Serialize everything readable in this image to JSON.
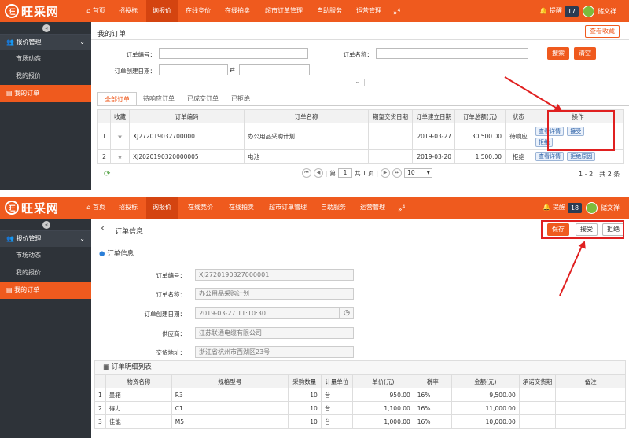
{
  "logo": {
    "mark": "旺",
    "text": "旺采网"
  },
  "nav": {
    "items": [
      "首页",
      "招投标",
      "询报价",
      "在线竞价",
      "在线拍卖",
      "超市订单管理",
      "自助服务",
      "运营管理"
    ],
    "more": "»",
    "more_count": "4"
  },
  "notice": {
    "label": "提醒"
  },
  "user": {
    "name": "储文祥"
  },
  "sidebar": {
    "toggle": "«",
    "group": "报价管理",
    "items": [
      "市场动态",
      "我的报价",
      "我的订单"
    ]
  },
  "panel1": {
    "notice_count": "17",
    "page_title": "我的订单",
    "view_fav": "查看收藏",
    "search": {
      "order_no_label": "订单编号：",
      "order_name_label": "订单名称：",
      "created_date_label": "订单创建日期：",
      "range_sep": "⇄",
      "search_btn": "搜索",
      "clear_btn": "清空",
      "collapse": "⌄"
    },
    "tabs": [
      "全部订单",
      "待响应订单",
      "已成交订单",
      "已拒绝"
    ],
    "table": {
      "headers": [
        "",
        "收藏",
        "订单编码",
        "订单名称",
        "期望交货日期",
        "订单建立日期",
        "订单总额(元)",
        "状态",
        "操作"
      ],
      "rows": [
        {
          "idx": "1",
          "code": "XJ2720190327000001",
          "name": "办公用品采购计划",
          "expected": "",
          "created": "2019-03-27",
          "total": "30,500.00",
          "status": "待响应",
          "actions": [
            "查看详情",
            "接受",
            "拒绝"
          ]
        },
        {
          "idx": "2",
          "code": "XJ2020190320000005",
          "name": "电池",
          "expected": "",
          "created": "2019-03-20",
          "total": "1,500.00",
          "status": "拒绝",
          "actions": [
            "查看详情",
            "拒绝原因"
          ]
        }
      ]
    },
    "pager": {
      "page_label_pre": "第",
      "page": "1",
      "page_label_post": "共 1 页",
      "size": "10",
      "summary": "1 - 2　共 2 条",
      "refresh": "⟳"
    }
  },
  "panel2": {
    "notice_count": "18",
    "back": "‹",
    "page_title": "订单信息",
    "save": "保存",
    "accept": "接受",
    "reject": "拒绝",
    "section_title": "订单信息",
    "fields": [
      {
        "label": "订单编号：",
        "value": "XJ2720190327000001"
      },
      {
        "label": "订单名称：",
        "value": "办公用品采购计划"
      },
      {
        "label": "订单创建日期：",
        "value": "2019-03-27 11:10:30"
      },
      {
        "label": "供应商：",
        "value": "江苏联通电缆有限公司"
      },
      {
        "label": "交货地址：",
        "value": "浙江省杭州市西湖区23号"
      }
    ],
    "clock": "◷",
    "detail_title": "订单明细列表",
    "detail": {
      "headers": [
        "",
        "物资名称",
        "规格型号",
        "采购数量",
        "计量单位",
        "单价(元)",
        "税率",
        "金额(元)",
        "承诺交货期",
        "备注"
      ],
      "rows": [
        {
          "idx": "1",
          "name": "墨箱",
          "spec": "R3",
          "qty": "10",
          "unit": "台",
          "price": "950.00",
          "tax": "16%",
          "amount": "9,500.00"
        },
        {
          "idx": "2",
          "name": "得力",
          "spec": "C1",
          "qty": "10",
          "unit": "台",
          "price": "1,100.00",
          "tax": "16%",
          "amount": "11,000.00"
        },
        {
          "idx": "3",
          "name": "佳能",
          "spec": "M5",
          "qty": "10",
          "unit": "台",
          "price": "1,000.00",
          "tax": "16%",
          "amount": "10,000.00"
        }
      ]
    }
  },
  "colors": {
    "brand": "#ef5a1e",
    "sidebar": "#2e3339",
    "annotation": "#e02020"
  },
  "icons": [
    "home-icon",
    "bell-icon",
    "chevron-down-icon",
    "users-icon",
    "order-icon",
    "star-icon",
    "refresh-icon",
    "grid-icon",
    "clock-icon"
  ]
}
